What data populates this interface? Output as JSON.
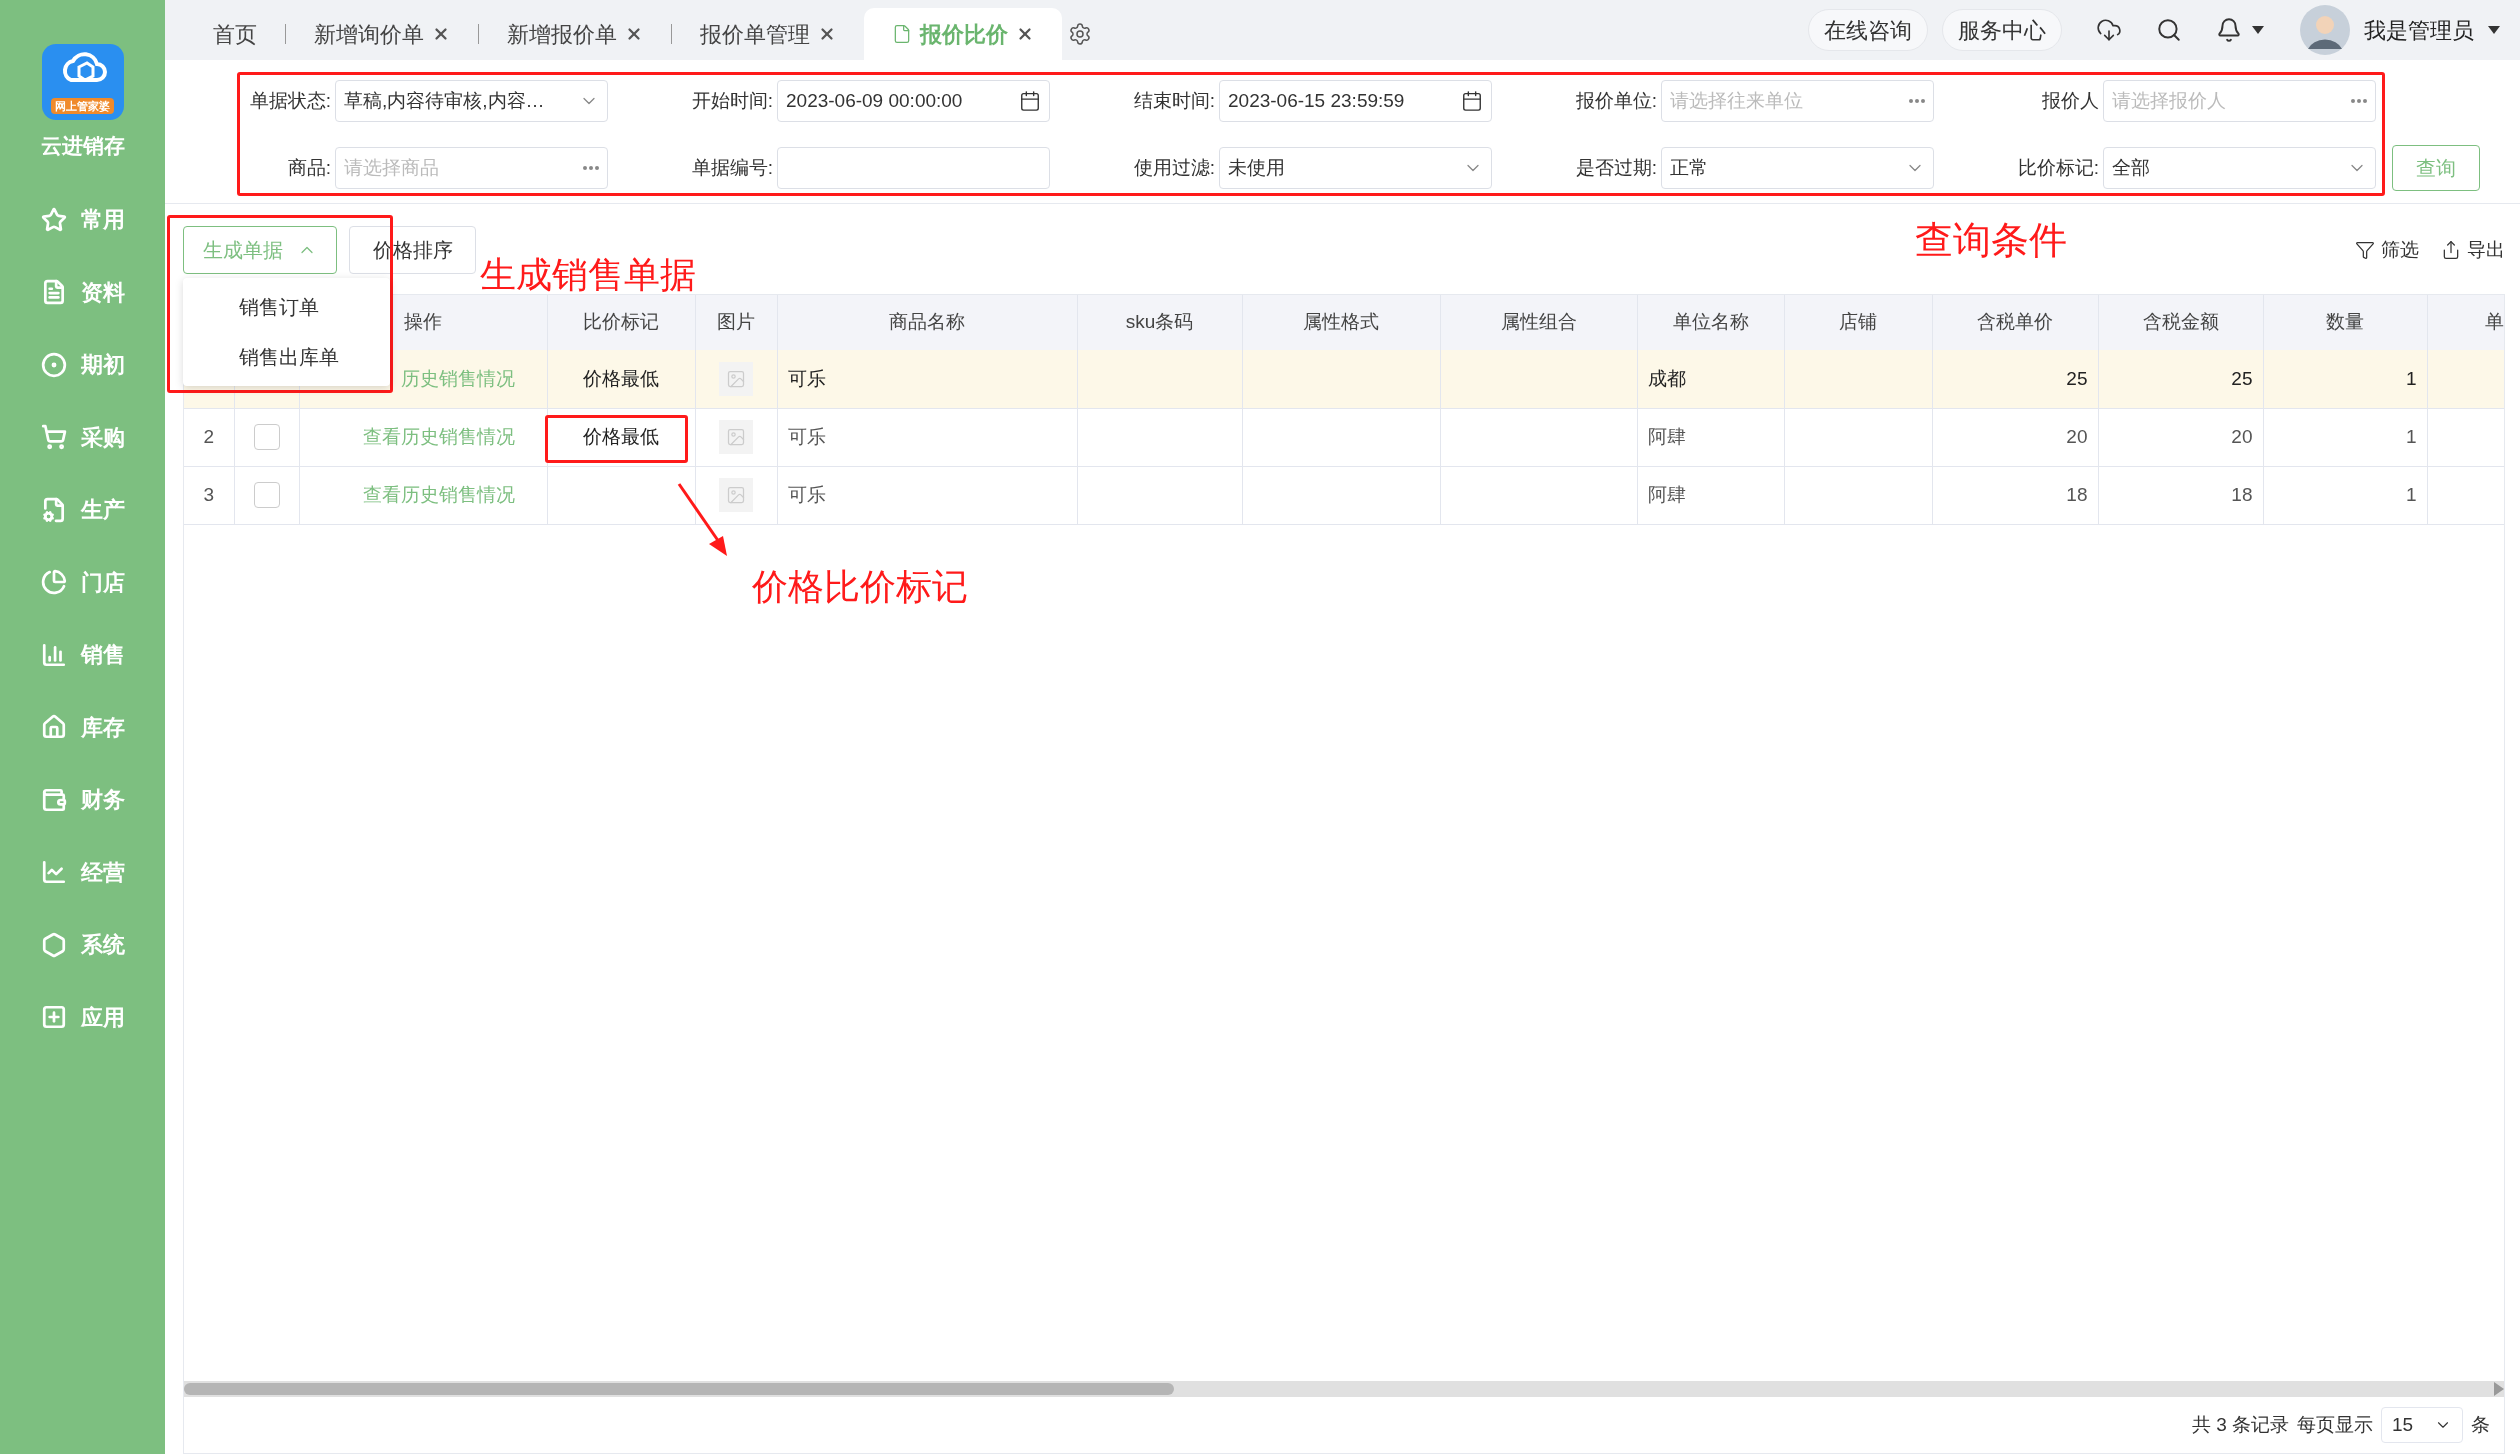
{
  "sidebar": {
    "logo_tag": "网上管家婆",
    "app_name": "云进销存",
    "items": [
      {
        "label": "常用"
      },
      {
        "label": "资料"
      },
      {
        "label": "期初"
      },
      {
        "label": "采购"
      },
      {
        "label": "生产"
      },
      {
        "label": "门店"
      },
      {
        "label": "销售"
      },
      {
        "label": "库存"
      },
      {
        "label": "财务"
      },
      {
        "label": "经营"
      },
      {
        "label": "系统"
      },
      {
        "label": "应用"
      }
    ]
  },
  "tabs": [
    {
      "label": "首页",
      "closable": false,
      "selected": false
    },
    {
      "label": "新增询价单",
      "closable": true,
      "selected": false
    },
    {
      "label": "新增报价单",
      "closable": true,
      "selected": false
    },
    {
      "label": "报价单管理",
      "closable": true,
      "selected": false
    },
    {
      "label": "报价比价",
      "closable": true,
      "selected": true
    }
  ],
  "top_bar": {
    "buttons": [
      "在线咨询",
      "服务中心"
    ],
    "user": "我是管理员"
  },
  "filters": [
    {
      "label": "单据状态:",
      "kind": "select",
      "value": "草稿,内容待审核,内容…"
    },
    {
      "label": "开始时间:",
      "kind": "date",
      "value": "2023-06-09 00:00:00"
    },
    {
      "label": "结束时间:",
      "kind": "date",
      "value": "2023-06-15 23:59:59"
    },
    {
      "label": "报价单位:",
      "kind": "picker",
      "placeholder": "请选择往来单位"
    },
    {
      "label": "报价人",
      "kind": "picker",
      "placeholder": "请选择报价人"
    },
    {
      "label": "商品:",
      "kind": "picker",
      "placeholder": "请选择商品"
    },
    {
      "label": "单据编号:",
      "kind": "text"
    },
    {
      "label": "使用过滤:",
      "kind": "select",
      "value": "未使用"
    },
    {
      "label": "是否过期:",
      "kind": "select",
      "value": "正常"
    },
    {
      "label": "比价标记:",
      "kind": "select",
      "value": "全部"
    }
  ],
  "query_button": "查询",
  "toolbar": {
    "generate_button": {
      "label": "生成单据",
      "expanded": true
    },
    "sort_button": "价格排序",
    "actions": [
      "筛选",
      "导出"
    ]
  },
  "dropdown_menu": [
    "销售订单",
    "销售出库单"
  ],
  "table": {
    "columns": [
      "操作",
      "比价标记",
      "图片",
      "商品名称",
      "sku条码",
      "属性格式",
      "属性组合",
      "单位名称",
      "店铺",
      "含税单价",
      "含税金额",
      "数量",
      "单"
    ],
    "rows": [
      {
        "highlighted": true,
        "action": "历史销售情况",
        "mark": "价格最低",
        "name": "可乐",
        "unit": "成都",
        "price": "25",
        "amount": "25",
        "qty": "1"
      },
      {
        "highlighted": false,
        "index": "2",
        "checked": false,
        "action": "查看历史销售情况",
        "mark": "价格最低",
        "name": "可乐",
        "unit": "阿肆",
        "price": "20",
        "amount": "20",
        "qty": "1"
      },
      {
        "highlighted": false,
        "index": "3",
        "checked": false,
        "action": "查看历史销售情况",
        "name": "可乐",
        "unit": "阿肆",
        "price": "18",
        "amount": "18",
        "qty": "1"
      }
    ]
  },
  "pagination": {
    "summary": "共 3 条记录",
    "per_page_label": "每页显示",
    "per_page": "15",
    "unit": "条"
  },
  "annotations": [
    "查询条件",
    "生成销售单据",
    "价格比价标记"
  ]
}
